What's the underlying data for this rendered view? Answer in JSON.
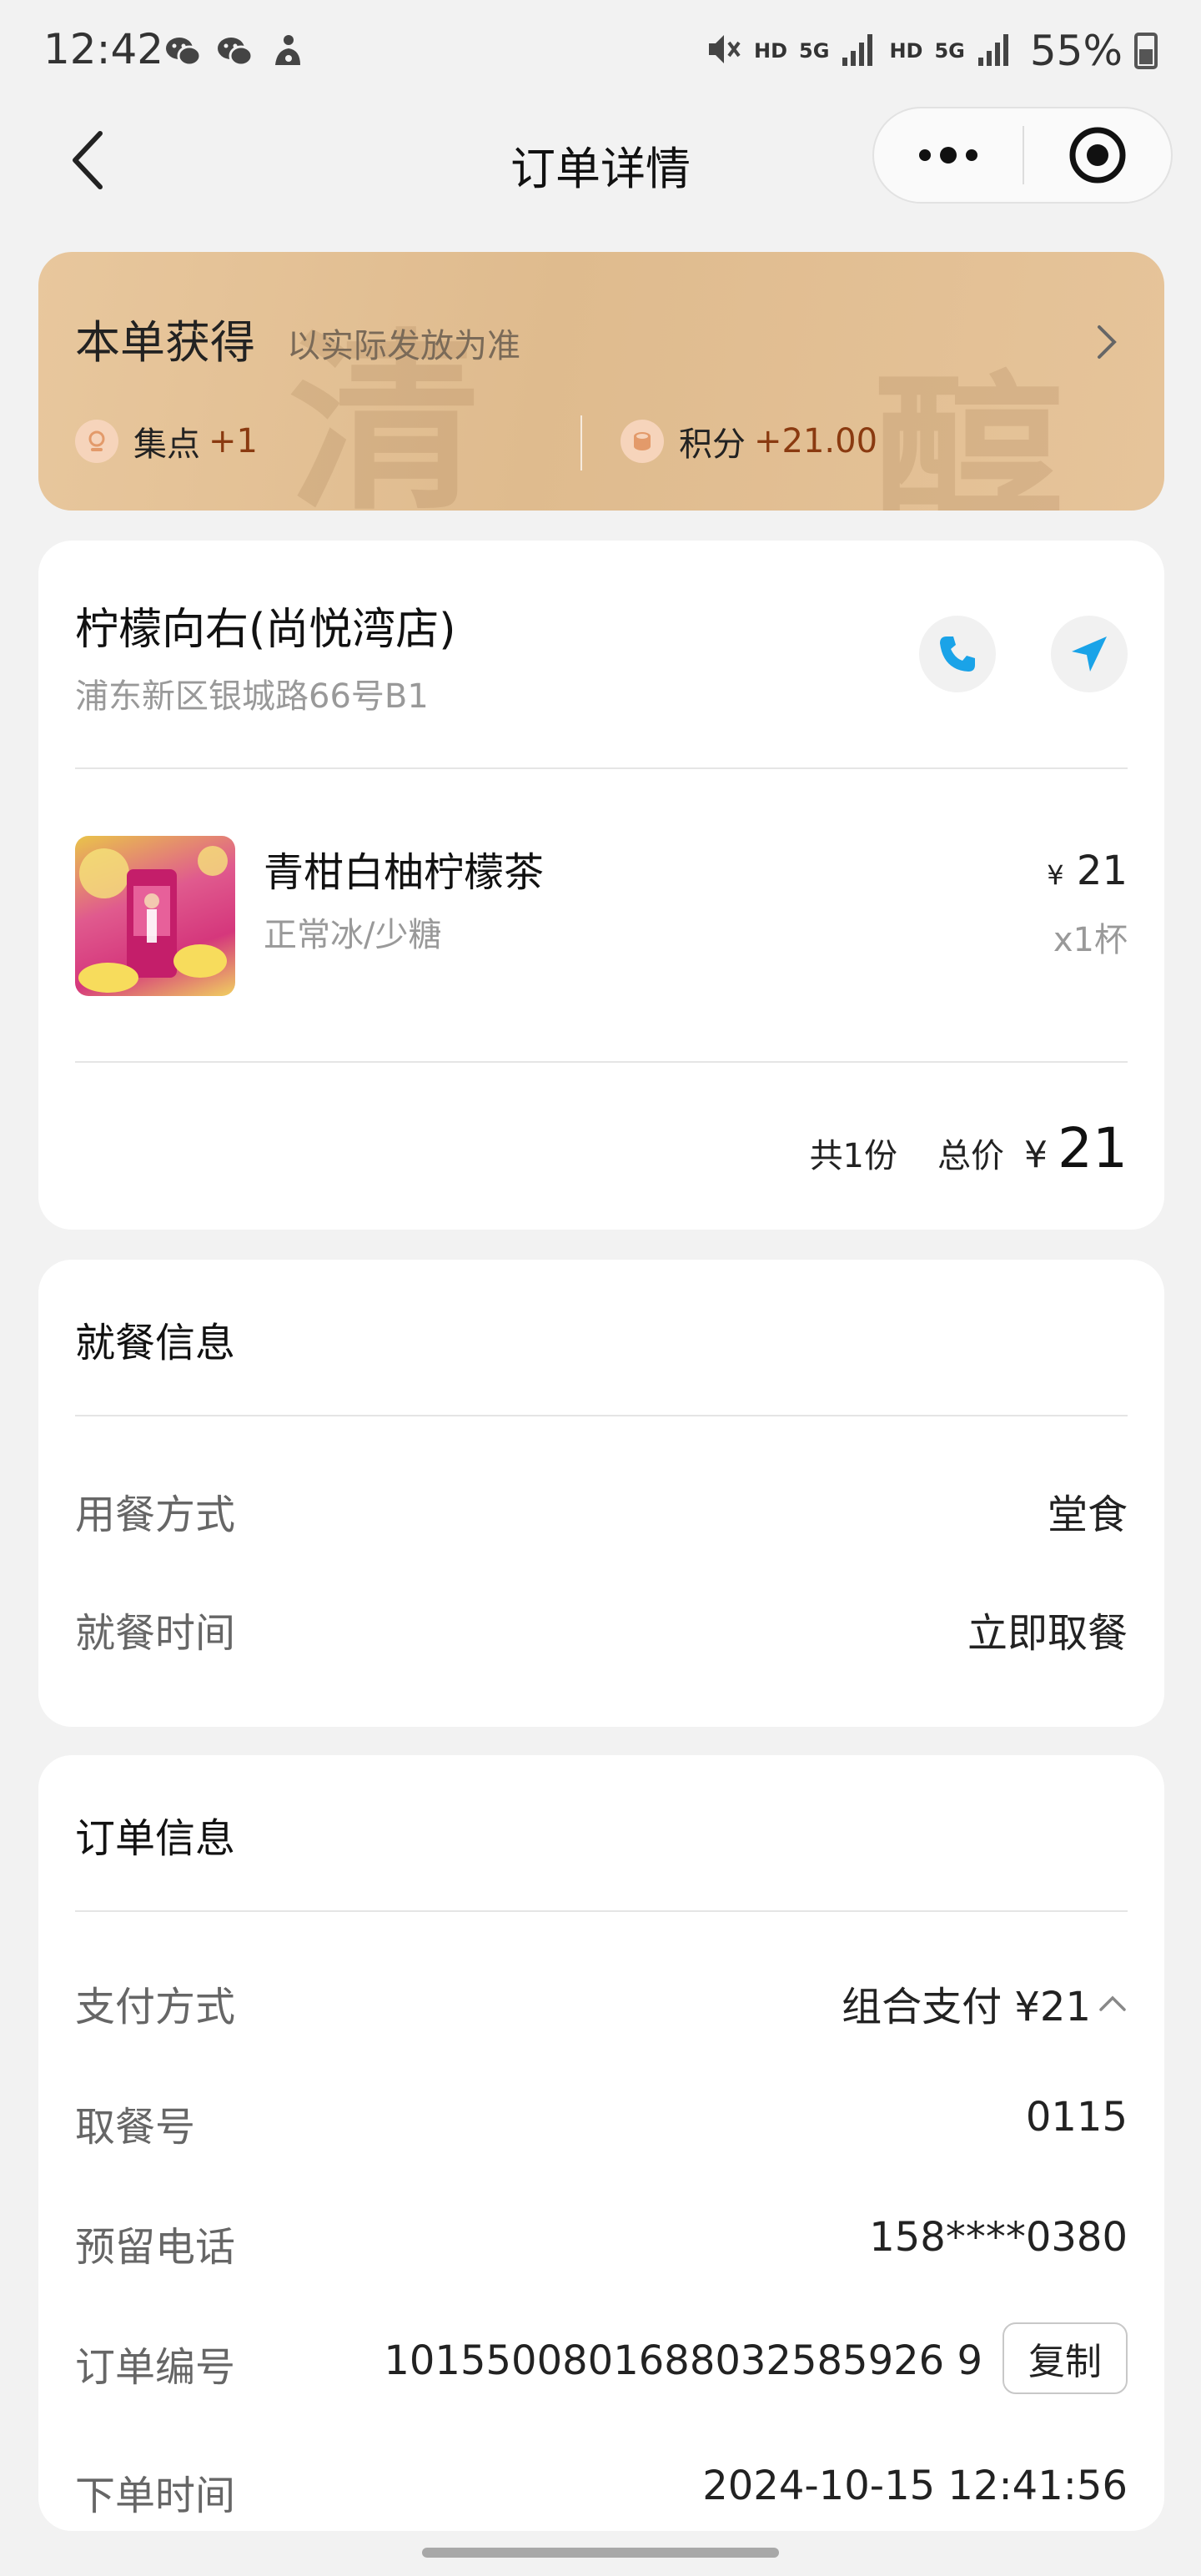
{
  "status_bar": {
    "time": "12:42",
    "hd1": "HD",
    "net1": "5G",
    "hd2": "HD",
    "net2": "5G",
    "battery": "55%"
  },
  "nav": {
    "title": "订单详情"
  },
  "reward": {
    "title": "本单获得",
    "subtitle": "以实际发放为准",
    "watermark1": "清",
    "watermark2": "醇",
    "stamps_label": "集点",
    "stamps_value": "+1",
    "points_label": "积分",
    "points_value": "+21.00"
  },
  "store": {
    "name": "柠檬向右(尚悦湾店)",
    "address": "浦东新区银城路66号B1"
  },
  "product": {
    "name": "青柑白柚柠檬茶",
    "spec": "正常冰/少糖",
    "currency": "¥",
    "price": "21",
    "qty": "x1杯"
  },
  "summary": {
    "count": "共1份",
    "total_label": "总价",
    "currency": "¥",
    "total": "21"
  },
  "dining": {
    "title": "就餐信息",
    "rows": [
      {
        "label": "用餐方式",
        "value": "堂食"
      },
      {
        "label": "就餐时间",
        "value": "立即取餐"
      }
    ]
  },
  "order": {
    "title": "订单信息",
    "payment_label": "支付方式",
    "payment_value": "组合支付 ¥21",
    "pickup_label": "取餐号",
    "pickup_value": "0115",
    "phone_label": "预留电话",
    "phone_value": "158****0380",
    "number_label": "订单编号",
    "number_value": "1015500801688032585926 9",
    "copy_label": "复制",
    "time_label": "下单时间",
    "time_value": "2024-10-15 12:41:56"
  },
  "colors": {
    "accent_blue": "#1aa3e8",
    "reward_value": "#8a3a10",
    "banner_bg": "#e2bf93"
  }
}
